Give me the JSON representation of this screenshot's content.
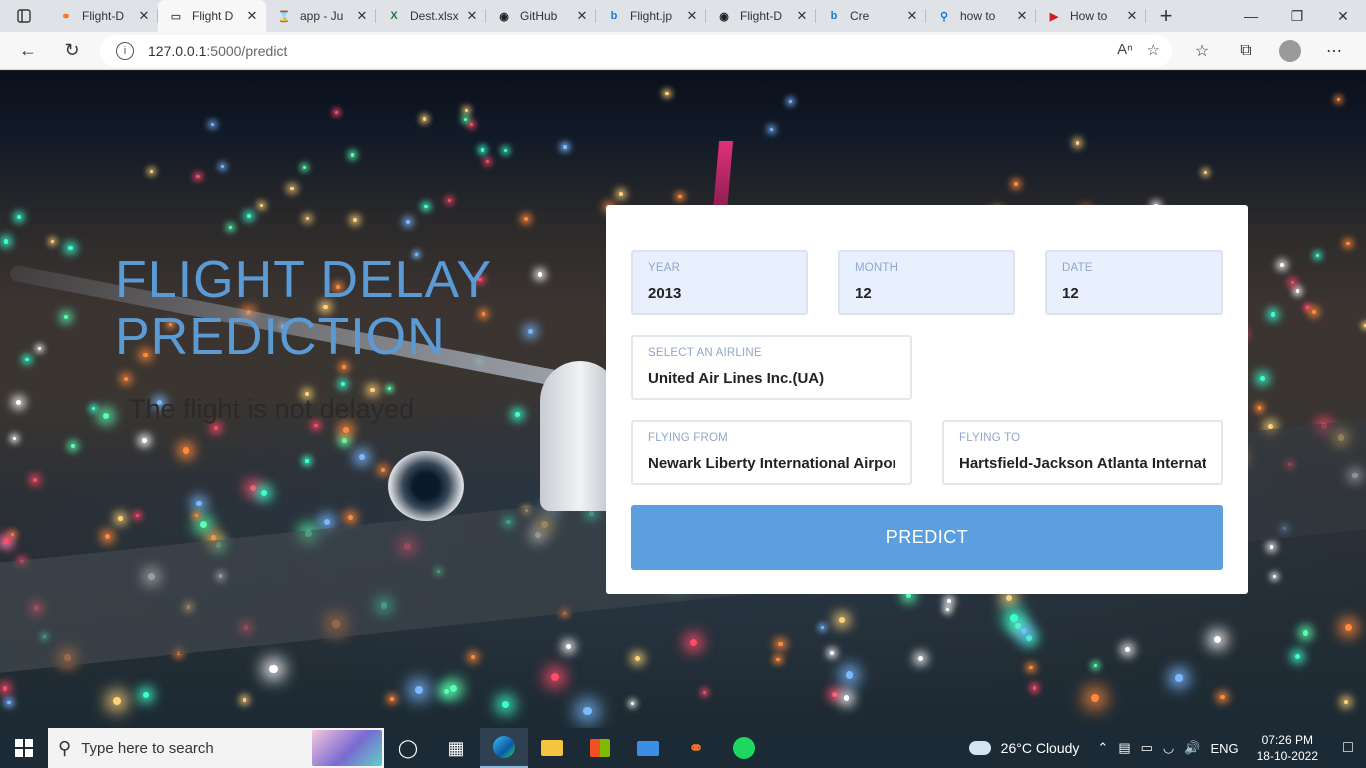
{
  "browser": {
    "tabs": [
      {
        "title": "Flight-D",
        "favicon": "jupyter-icon",
        "favicon_color": "#f37626",
        "active": false
      },
      {
        "title": "Flight D",
        "favicon": "page-icon",
        "favicon_color": "#555555",
        "active": true
      },
      {
        "title": "app - Ju",
        "favicon": "hourglass-icon",
        "favicon_color": "#f08a24",
        "active": false
      },
      {
        "title": "Dest.xlsx",
        "favicon": "excel-icon",
        "favicon_color": "#1d7a43",
        "active": false
      },
      {
        "title": "GitHub",
        "favicon": "github-icon",
        "favicon_color": "#222222",
        "active": false
      },
      {
        "title": "Flight.jp",
        "favicon": "bing-icon",
        "favicon_color": "#1a7ad8",
        "active": false
      },
      {
        "title": "Flight-D",
        "favicon": "github-icon",
        "favicon_color": "#222222",
        "active": false
      },
      {
        "title": "Cre",
        "favicon": "bing-icon",
        "favicon_color": "#1a7ad8",
        "active": false
      },
      {
        "title": "how to",
        "favicon": "search-icon",
        "favicon_color": "#1a7ad8",
        "active": false
      },
      {
        "title": "How to",
        "favicon": "youtube-icon",
        "favicon_color": "#d02020",
        "active": false
      }
    ],
    "url": {
      "host": "127.0.0.1",
      "path": ":5000/predict"
    }
  },
  "page": {
    "title": "FLIGHT DELAY PREDICTION",
    "result": "The flight is not delayed",
    "form": {
      "year": {
        "label": "YEAR",
        "value": "2013"
      },
      "month": {
        "label": "MONTH",
        "value": "12"
      },
      "date": {
        "label": "DATE",
        "value": "12"
      },
      "airline": {
        "label": "SELECT AN AIRLINE",
        "value": "United Air Lines Inc.(UA)"
      },
      "origin": {
        "label": "FLYING FROM",
        "value": "Newark Liberty International Airport"
      },
      "destination": {
        "label": "FLYING TO",
        "value": "Hartsfield-Jackson Atlanta International Airport"
      },
      "submit_label": "PREDICT"
    },
    "colors": {
      "accent": "#5b9fdf",
      "title": "#5b9bd5"
    }
  },
  "taskbar": {
    "search_placeholder": "Type here to search",
    "weather": "26°C  Cloudy",
    "language": "ENG",
    "time": "07:26 PM",
    "date": "18-10-2022"
  }
}
